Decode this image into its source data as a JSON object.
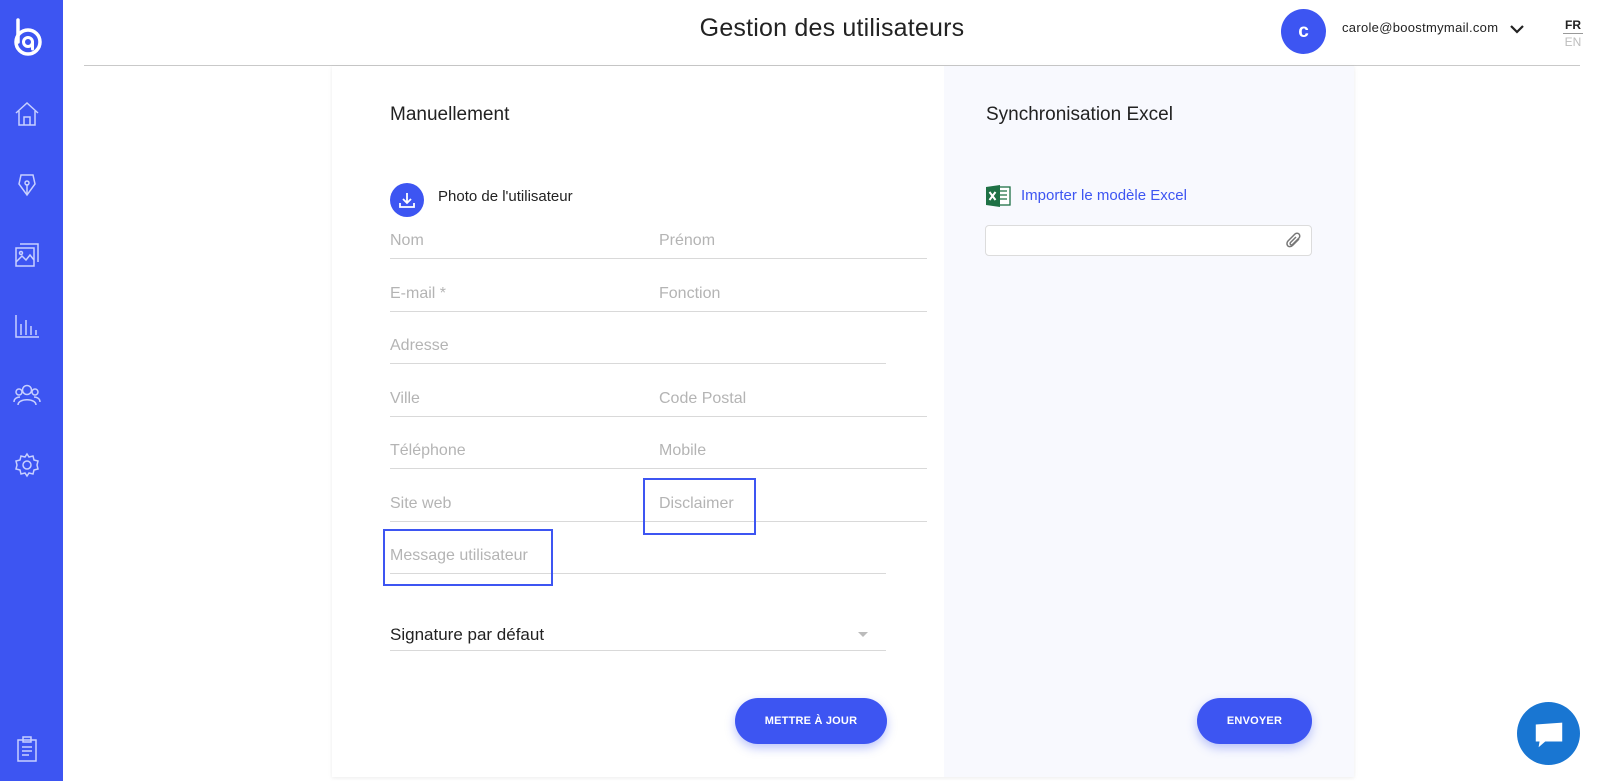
{
  "header": {
    "title": "Gestion des utilisateurs",
    "avatar_initial": "c",
    "user_email": "carole@boostmymail.com",
    "lang_active": "FR",
    "lang_other": "EN"
  },
  "manual": {
    "title": "Manuellement",
    "photo_label": "Photo de l'utilisateur",
    "fields": {
      "nom": "Nom",
      "prenom": "Prénom",
      "email": "E-mail *",
      "fonction": "Fonction",
      "adresse": "Adresse",
      "ville": "Ville",
      "code_postal": "Code Postal",
      "telephone": "Téléphone",
      "mobile": "Mobile",
      "site_web": "Site web",
      "disclaimer": "Disclaimer",
      "message": "Message utilisateur"
    },
    "signature_select": "Signature par défaut",
    "submit_label": "METTRE À JOUR"
  },
  "excel": {
    "title": "Synchronisation Excel",
    "import_link": "Importer le modèle Excel",
    "submit_label": "ENVOYER"
  },
  "sidebar": {
    "items": [
      "home-icon",
      "pen-icon",
      "gallery-icon",
      "chart-icon",
      "users-icon",
      "settings-icon",
      "clipboard-icon"
    ]
  },
  "colors": {
    "accent": "#3d55f2",
    "chat": "#1976d2"
  }
}
